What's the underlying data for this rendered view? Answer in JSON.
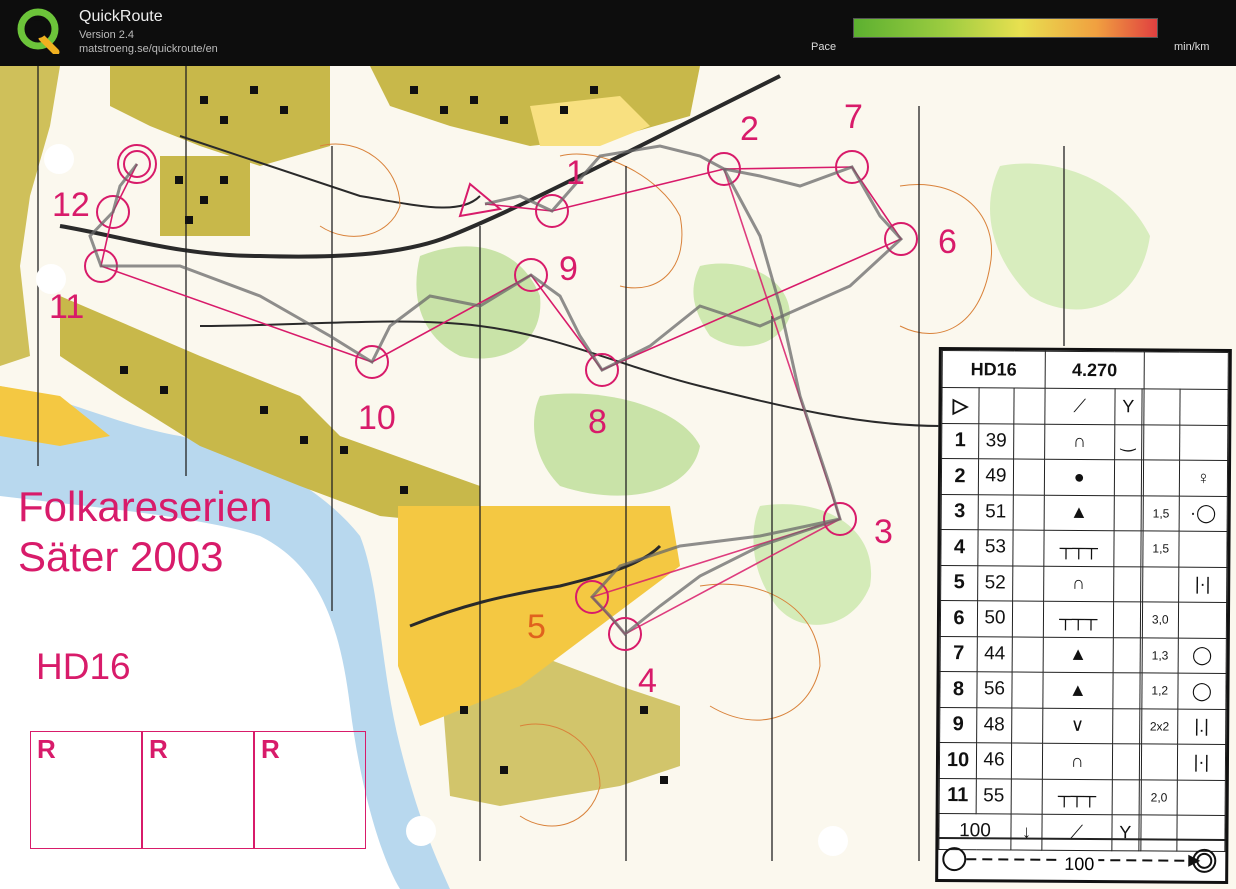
{
  "header": {
    "app_name": "QuickRoute",
    "version": "Version 2.4",
    "url": "matstroeng.se/quickroute/en",
    "pace_label": "Pace",
    "pace_unit": "min/km"
  },
  "map": {
    "event_title_line1": "Folkareserien",
    "event_title_line2": "Säter 2003",
    "class_label": "HD16",
    "control_numbers": [
      "1",
      "2",
      "3",
      "4",
      "5",
      "6",
      "7",
      "8",
      "9",
      "10",
      "11",
      "12"
    ],
    "relay_boxes": [
      "R",
      "R",
      "R"
    ],
    "colors": {
      "course": "#d81b6a",
      "route": "#6a6a6a",
      "road": "#2a2a2a",
      "water": "#b8d8ee",
      "urban": "#c8b84a",
      "field": "#f4c842",
      "forest_green": "#c9e3a8"
    }
  },
  "description_sheet": {
    "class": "HD16",
    "length": "4.270",
    "start_symbol": "▷",
    "start_col4": "⟋",
    "start_col5": "Y",
    "rows": [
      {
        "num": "1",
        "code": "39",
        "feature": "∩",
        "extra": "‿",
        "dim": "",
        "detail": ""
      },
      {
        "num": "2",
        "code": "49",
        "feature": "●",
        "extra": "",
        "dim": "",
        "detail": "♀"
      },
      {
        "num": "3",
        "code": "51",
        "feature": "▲",
        "extra": "",
        "dim": "1,5",
        "detail": "·◯"
      },
      {
        "num": "4",
        "code": "53",
        "feature": "┬┬┬",
        "extra": "",
        "dim": "1,5",
        "detail": ""
      },
      {
        "num": "5",
        "code": "52",
        "feature": "∩",
        "extra": "",
        "dim": "",
        "detail": "|·|"
      },
      {
        "num": "6",
        "code": "50",
        "feature": "┬┬┬",
        "extra": "",
        "dim": "3,0",
        "detail": ""
      },
      {
        "num": "7",
        "code": "44",
        "feature": "▲",
        "extra": "",
        "dim": "1,3",
        "detail": "◯"
      },
      {
        "num": "8",
        "code": "56",
        "feature": "▲",
        "extra": "",
        "dim": "1,2",
        "detail": "◯"
      },
      {
        "num": "9",
        "code": "48",
        "feature": "∨",
        "extra": "",
        "dim": "2x2",
        "detail": "|.|"
      },
      {
        "num": "10",
        "code": "46",
        "feature": "∩",
        "extra": "",
        "dim": "",
        "detail": "|·|"
      },
      {
        "num": "11",
        "code": "55",
        "feature": "┬┬┬",
        "extra": "",
        "dim": "2,0",
        "detail": ""
      }
    ],
    "last_leg": {
      "distance": "100",
      "arrow": "↓",
      "col4": "⟋",
      "col5": "Y"
    },
    "finish_distance": "100"
  }
}
